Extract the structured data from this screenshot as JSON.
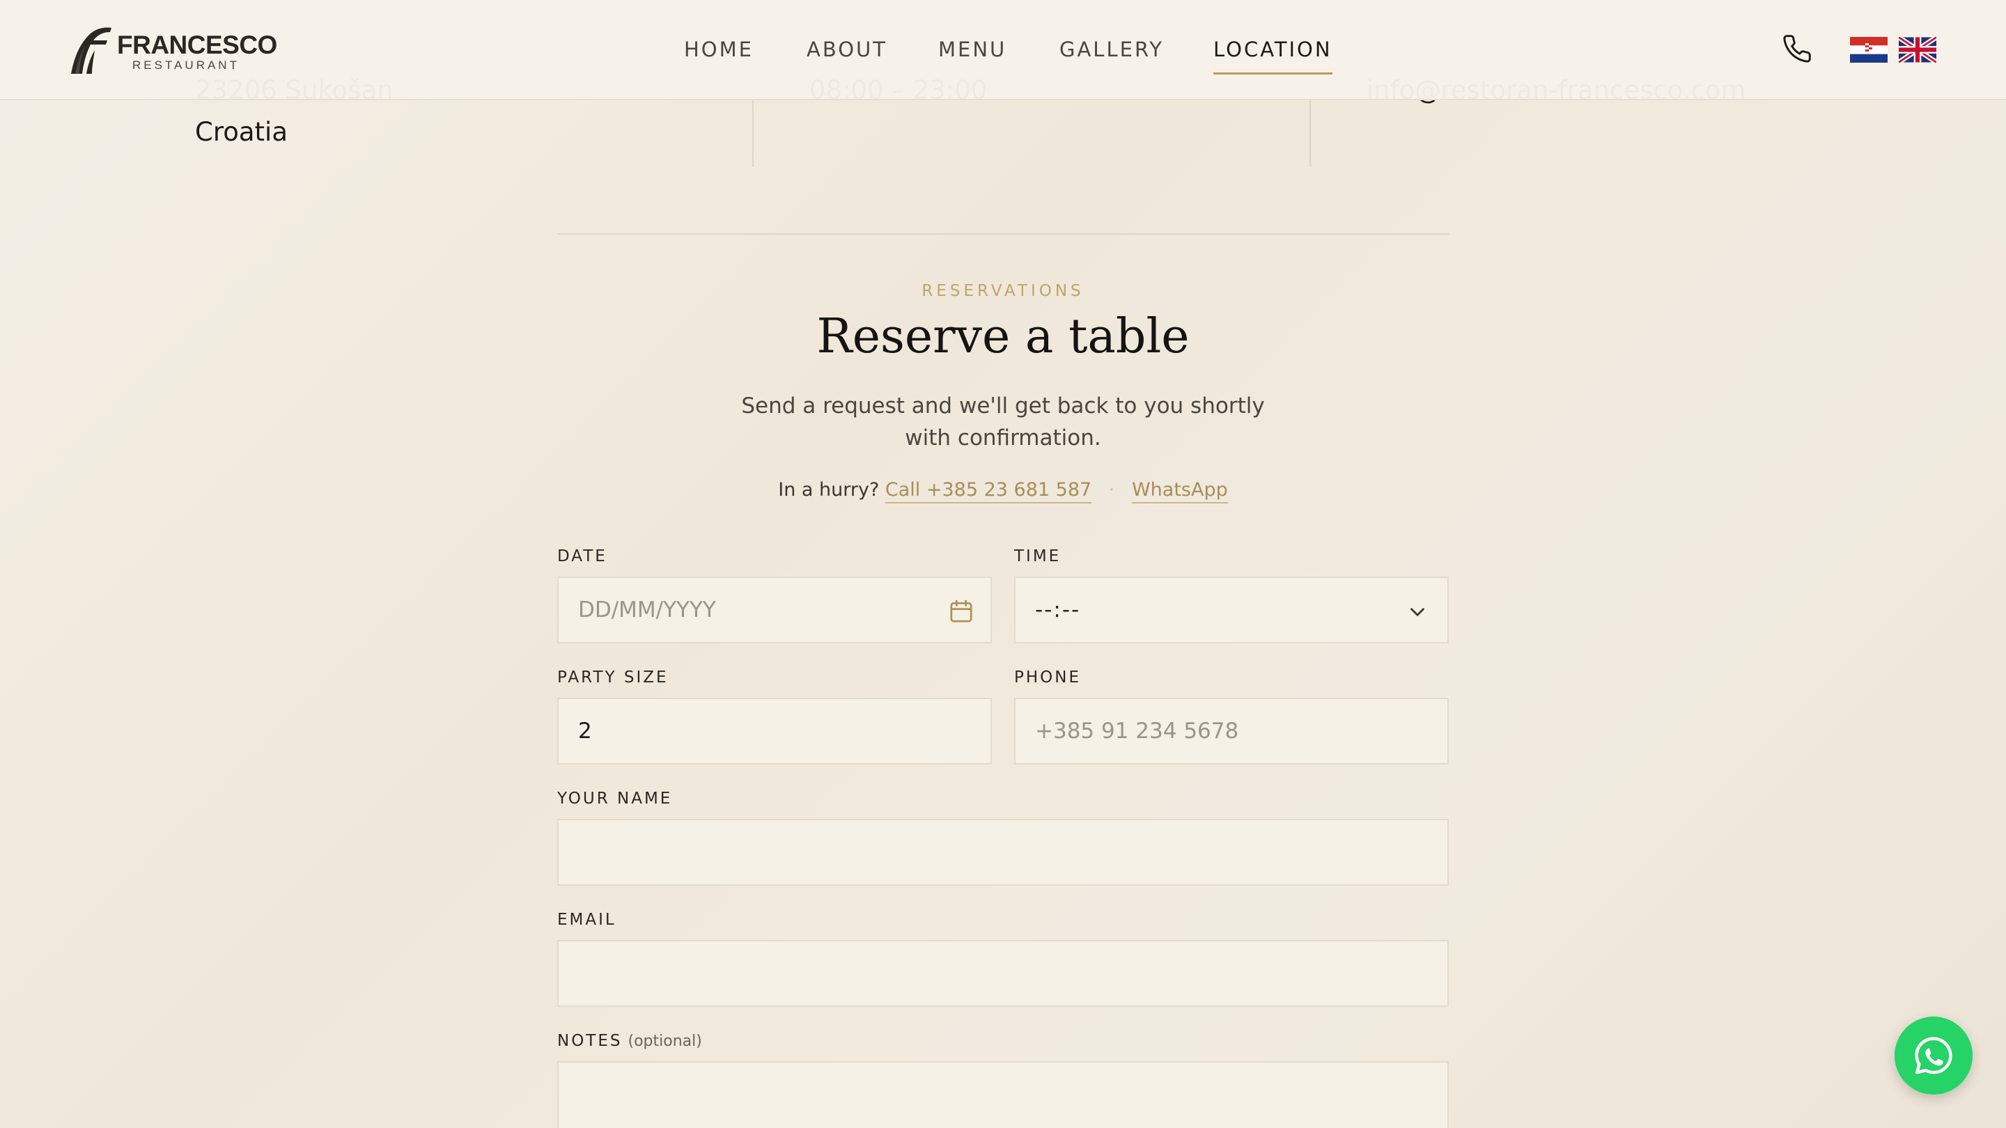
{
  "header": {
    "logo_name": "FRANCESCO",
    "logo_sub": "RESTAURANT",
    "nav": [
      {
        "label": "HOME"
      },
      {
        "label": "ABOUT"
      },
      {
        "label": "MENU"
      },
      {
        "label": "GALLERY"
      },
      {
        "label": "LOCATION",
        "active": true
      }
    ],
    "icons": [
      "phone-icon",
      "flag-croatia-icon",
      "flag-uk-icon"
    ]
  },
  "info": {
    "address_line1": "23206 Sukošan",
    "address_line2": "Croatia",
    "hours": "08:00 – 23:00",
    "email": "info@restoran-francesco.com"
  },
  "reservation": {
    "eyebrow": "RESERVATIONS",
    "title": "Reserve a table",
    "subtitle": "Send a request and we'll get back to you shortly with confirmation.",
    "hurry_prefix": "In a hurry?",
    "call_link": "Call +385 23 681 587",
    "separator": "·",
    "whatsapp_link": "WhatsApp",
    "fields": {
      "date": {
        "label": "DATE",
        "placeholder": "DD/MM/YYYY"
      },
      "time": {
        "label": "TIME",
        "value": "--:--"
      },
      "party": {
        "label": "PARTY SIZE",
        "value": "2"
      },
      "phone": {
        "label": "PHONE",
        "placeholder": "+385 91 234 5678"
      },
      "name": {
        "label": "YOUR NAME",
        "value": ""
      },
      "email": {
        "label": "EMAIL",
        "value": ""
      },
      "notes": {
        "label": "NOTES",
        "optional": "(optional)",
        "value": ""
      }
    }
  },
  "colors": {
    "accent_gold": "#b99a5e",
    "whatsapp_green": "#25d366",
    "background": "#f0ebe1"
  }
}
